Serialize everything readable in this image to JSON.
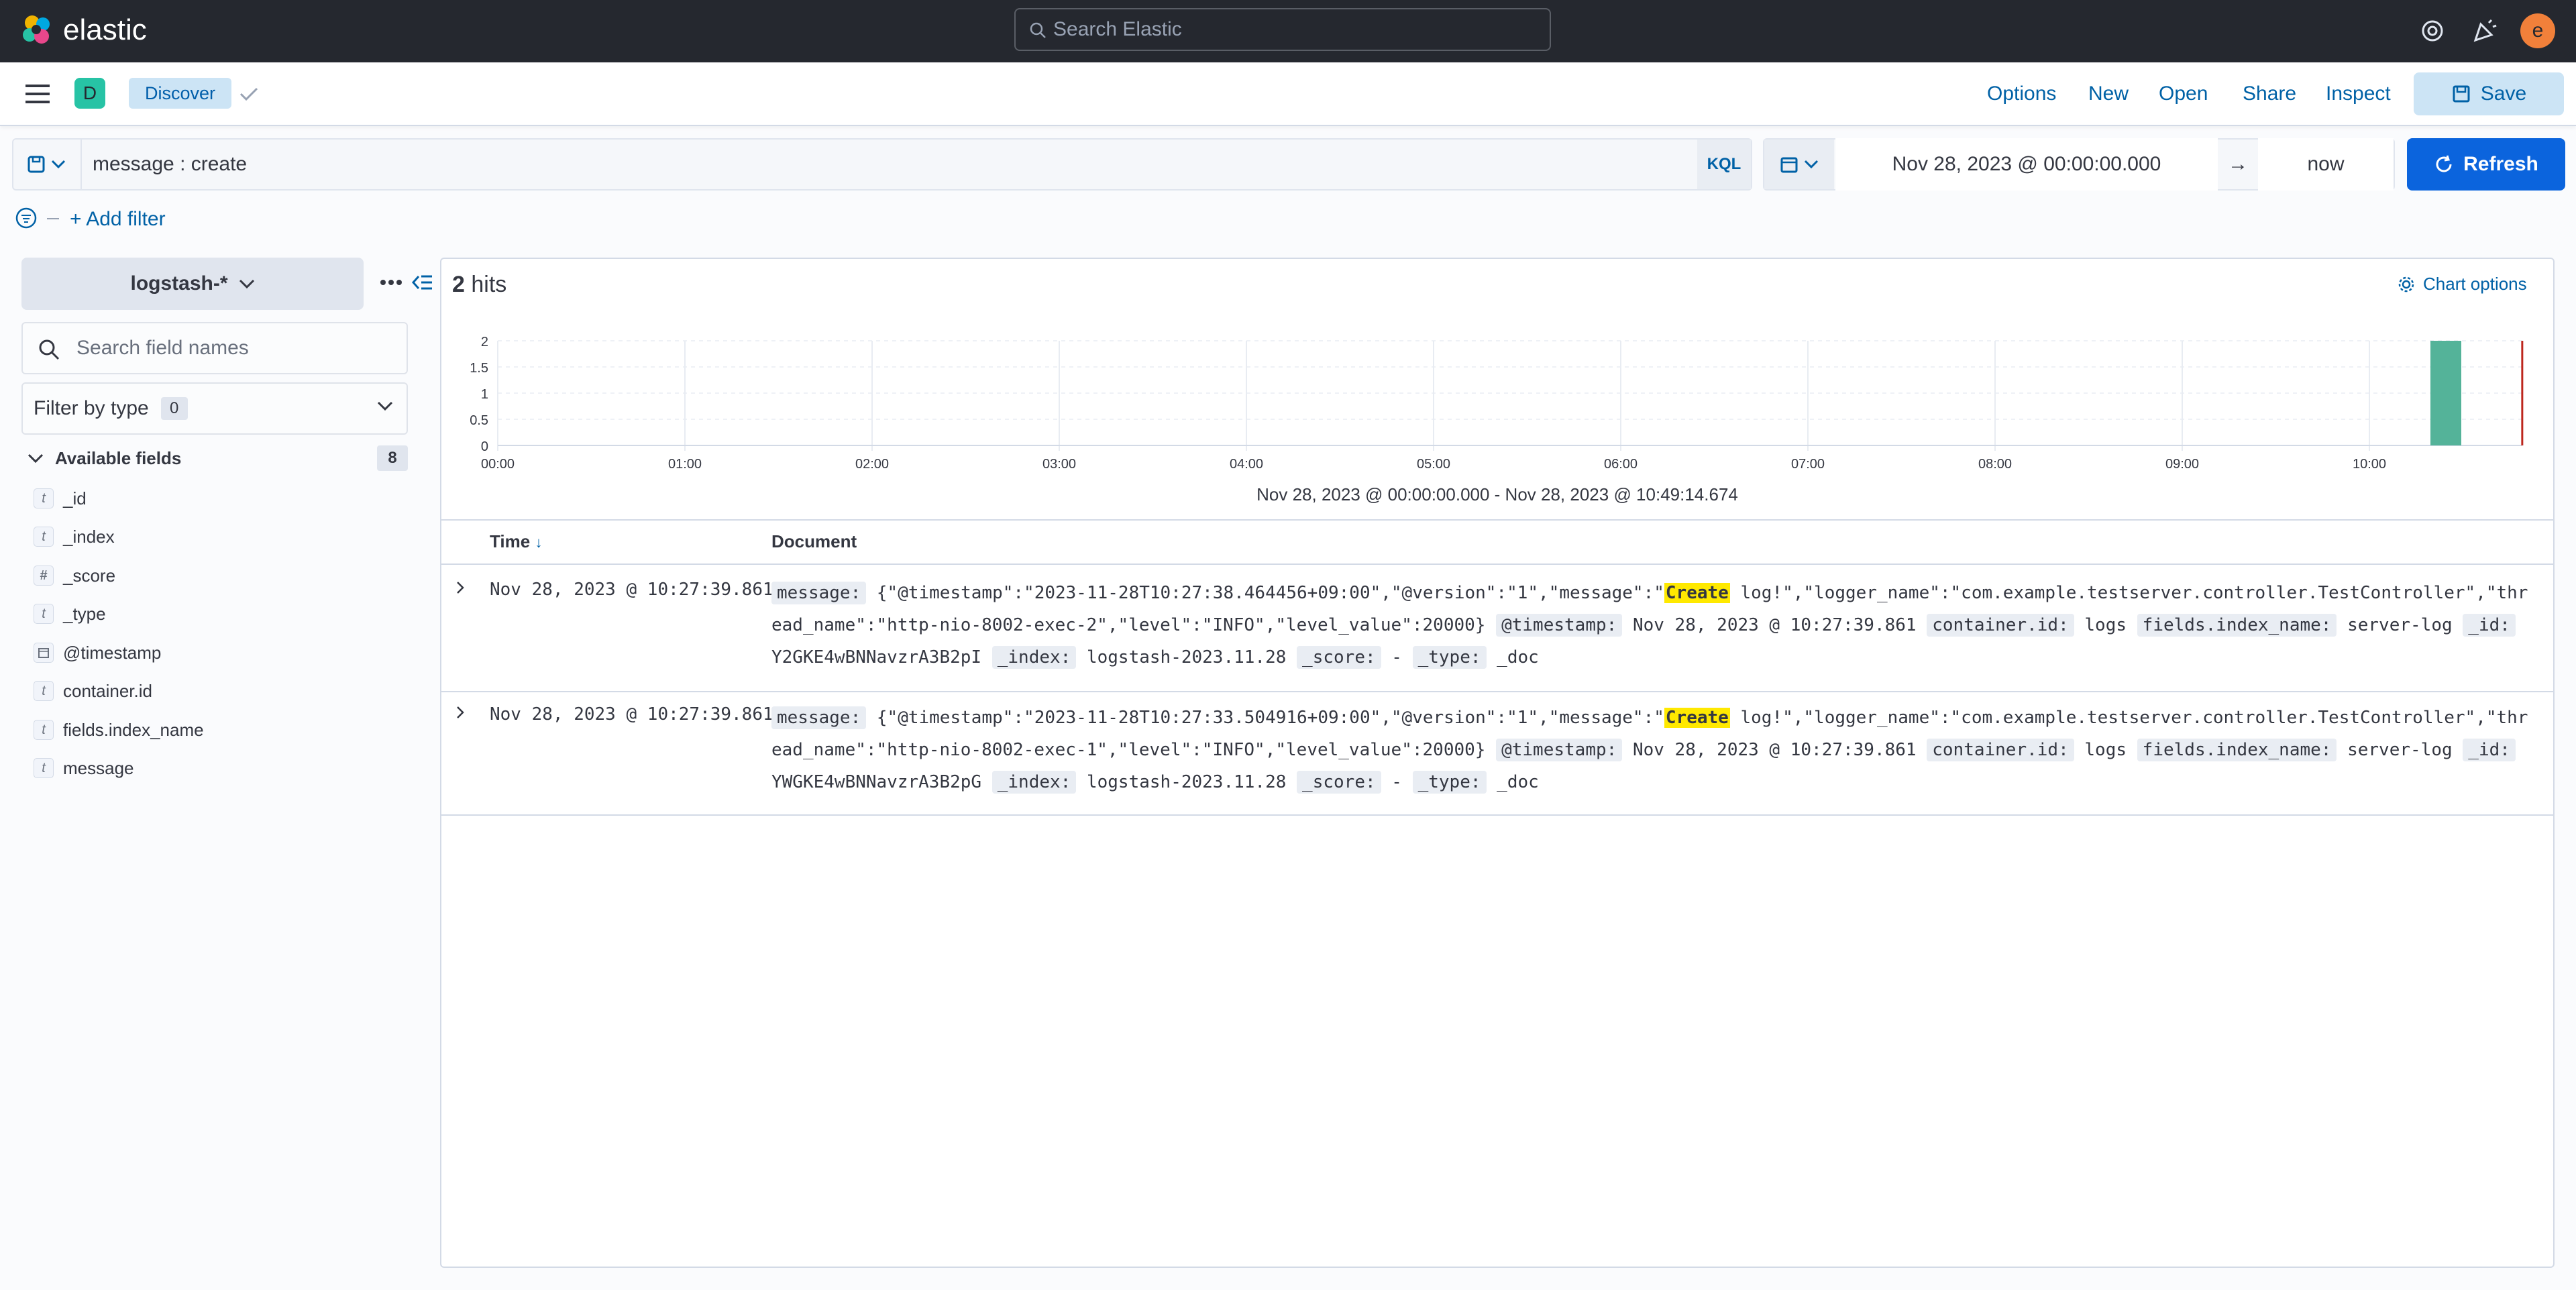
{
  "brand": {
    "name": "elastic"
  },
  "header": {
    "search_placeholder": "Search Elastic",
    "avatar_initial": "e"
  },
  "nav": {
    "space_initial": "D",
    "breadcrumb": "Discover",
    "menu": [
      "Options",
      "New",
      "Open",
      "Share",
      "Inspect"
    ],
    "save_label": "Save"
  },
  "query": {
    "value": "message : create",
    "language": "KQL",
    "date_start": "Nov 28, 2023 @ 00:00:00.000",
    "date_end": "now",
    "refresh_label": "Refresh",
    "add_filter": "+ Add filter"
  },
  "sidebar": {
    "index_pattern": "logstash-*",
    "search_placeholder": "Search field names",
    "filter_by_type": "Filter by type",
    "filter_count": "0",
    "available_label": "Available fields",
    "available_count": "8",
    "fields": [
      {
        "name": "_id",
        "type": "t"
      },
      {
        "name": "_index",
        "type": "t"
      },
      {
        "name": "_score",
        "type": "#"
      },
      {
        "name": "_type",
        "type": "t"
      },
      {
        "name": "@timestamp",
        "type": "date"
      },
      {
        "name": "container.id",
        "type": "t"
      },
      {
        "name": "fields.index_name",
        "type": "t"
      },
      {
        "name": "message",
        "type": "t"
      }
    ]
  },
  "results": {
    "hits_count": "2",
    "hits_label": "hits",
    "chart_options": "Chart options",
    "time_range_label": "Nov 28, 2023 @ 00:00:00.000 - Nov 28, 2023 @ 10:49:14.674",
    "col_time": "Time",
    "col_document": "Document",
    "rows": [
      {
        "time": "Nov 28, 2023 @ 10:27:39.861",
        "message_pre": "{\"@timestamp\":\"2023-11-28T10:27:38.464456+09:00\",\"@version\":\"1\",\"message\":\"",
        "message_hl": "Create",
        "message_post": " log!\",\"logger_name\":\"com.example.testserver.controller.TestController\",\"thread_name\":\"http-nio-8002-exec-2\",\"level\":\"INFO\",\"level_value\":20000}",
        "timestamp": "Nov 28, 2023 @ 10:27:39.861",
        "container_id": "logs",
        "index_name": "server-log",
        "id": "Y2GKE4wBNNavzrA3B2pI",
        "index": "logstash-2023.11.28",
        "score": "-",
        "type": "_doc"
      },
      {
        "time": "Nov 28, 2023 @ 10:27:39.861",
        "message_pre": "{\"@timestamp\":\"2023-11-28T10:27:33.504916+09:00\",\"@version\":\"1\",\"message\":\"",
        "message_hl": "Create",
        "message_post": " log!\",\"logger_name\":\"com.example.testserver.controller.TestController\",\"thread_name\":\"http-nio-8002-exec-1\",\"level\":\"INFO\",\"level_value\":20000}",
        "timestamp": "Nov 28, 2023 @ 10:27:39.861",
        "container_id": "logs",
        "index_name": "server-log",
        "id": "YWGKE4wBNNavzrA3B2pG",
        "index": "logstash-2023.11.28",
        "score": "-",
        "type": "_doc"
      }
    ]
  },
  "chart_data": {
    "type": "bar",
    "x_ticks": [
      "00:00",
      "01:00",
      "02:00",
      "03:00",
      "04:00",
      "05:00",
      "06:00",
      "07:00",
      "08:00",
      "09:00",
      "10:00"
    ],
    "y_ticks": [
      "0",
      "0.5",
      "1",
      "1.5",
      "2"
    ],
    "ylim": [
      0,
      2
    ],
    "bars": [
      {
        "x": "10:20",
        "value": 2
      }
    ],
    "now_marker": "10:49",
    "bar_color": "#54b399",
    "marker_color": "#bd271e"
  },
  "colors": {
    "accent": "#0b64dd",
    "link": "#0061a6",
    "header_bg": "#25282f"
  }
}
